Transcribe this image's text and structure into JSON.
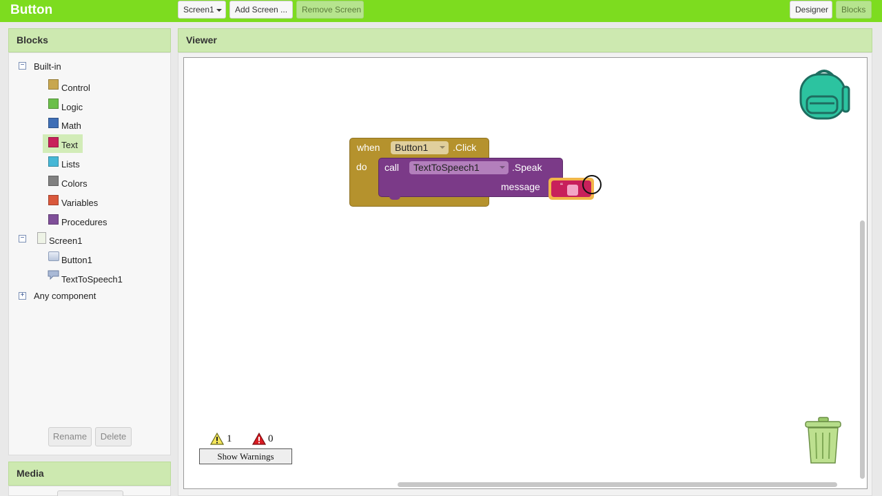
{
  "app": {
    "title": "Button"
  },
  "toolbar": {
    "screen_select": "Screen1",
    "add_screen": "Add Screen ...",
    "remove_screen": "Remove Screen",
    "designer": "Designer",
    "blocks": "Blocks"
  },
  "blocks_panel": {
    "title": "Blocks",
    "builtin": {
      "label": "Built-in",
      "items": [
        {
          "label": "Control",
          "color": "#c8a74f"
        },
        {
          "label": "Logic",
          "color": "#6bbf4a"
        },
        {
          "label": "Math",
          "color": "#3f6fb6"
        },
        {
          "label": "Text",
          "color": "#c8205b"
        },
        {
          "label": "Lists",
          "color": "#46b7d6"
        },
        {
          "label": "Colors",
          "color": "#808080"
        },
        {
          "label": "Variables",
          "color": "#d9583c"
        },
        {
          "label": "Procedures",
          "color": "#7f4f99"
        }
      ]
    },
    "screen": {
      "label": "Screen1",
      "items": [
        {
          "label": "Button1",
          "icon": "button-icon"
        },
        {
          "label": "TextToSpeech1",
          "icon": "speech-icon"
        }
      ]
    },
    "any_component": "Any component",
    "rename": "Rename",
    "delete": "Delete"
  },
  "media_panel": {
    "title": "Media"
  },
  "viewer": {
    "title": "Viewer",
    "event_block": {
      "when": "when",
      "component": "Button1",
      "event": ".Click",
      "do": "do"
    },
    "call_block": {
      "call": "call",
      "component": "TextToSpeech1",
      "method": ".Speak",
      "arg": "message"
    },
    "text_block": {
      "quote": "“"
    },
    "warnings": {
      "warning_count": "1",
      "error_count": "0",
      "show_warnings": "Show Warnings"
    }
  },
  "colors": {
    "topbar": "#7ddc1f",
    "event_block": "#b5922d",
    "call_block": "#7b3a88",
    "text_block": "#c8205b"
  }
}
